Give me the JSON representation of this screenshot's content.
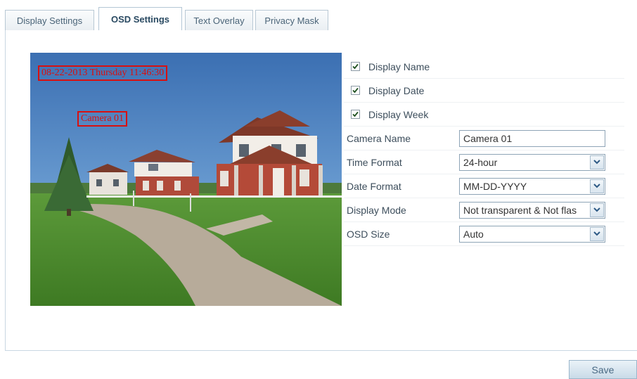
{
  "tabs": [
    {
      "label": "Display Settings",
      "active": false
    },
    {
      "label": "OSD Settings",
      "active": true
    },
    {
      "label": "Text Overlay",
      "active": false
    },
    {
      "label": "Privacy Mask",
      "active": false
    }
  ],
  "preview": {
    "osd_datetime": "08-22-2013 Thursday 11:46:30",
    "osd_camera_name": "Camera 01",
    "osd_color": "#d81010"
  },
  "checkboxes": [
    {
      "label": "Display Name",
      "checked": true
    },
    {
      "label": "Display Date",
      "checked": true
    },
    {
      "label": "Display Week",
      "checked": true
    }
  ],
  "fields": {
    "camera_name": {
      "label": "Camera Name",
      "value": "Camera 01"
    },
    "time_format": {
      "label": "Time Format",
      "value": "24-hour"
    },
    "date_format": {
      "label": "Date Format",
      "value": "MM-DD-YYYY"
    },
    "display_mode": {
      "label": "Display Mode",
      "value": "Not transparent & Not flas"
    },
    "osd_size": {
      "label": "OSD Size",
      "value": "Auto"
    }
  },
  "save_label": "Save",
  "colors": {
    "accent": "#2a4a62",
    "border": "#8ea4b6",
    "osd": "#d81010"
  },
  "icons": {
    "checkbox": "checkmark-icon",
    "dropdown": "chevron-down-icon"
  }
}
